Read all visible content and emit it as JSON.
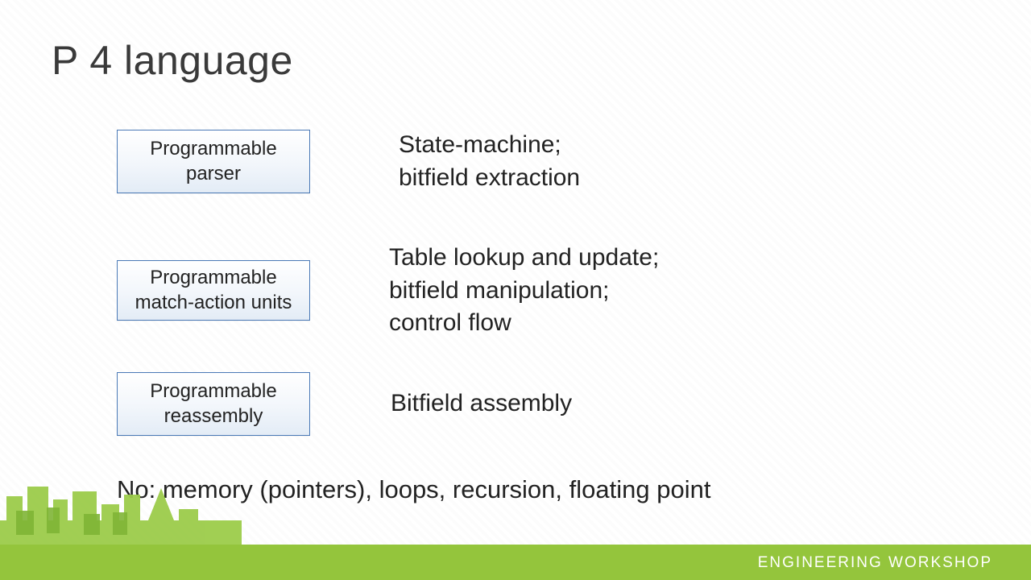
{
  "title": "P 4 language",
  "rows": [
    {
      "box": "Programmable\nparser",
      "desc": "State-machine;\nbitfield extraction"
    },
    {
      "box": "Programmable\nmatch-action\nunits",
      "desc": "Table lookup and update;\nbitfield manipulation;\ncontrol flow"
    },
    {
      "box": "Programmable\nreassembly",
      "desc": "Bitfield assembly"
    }
  ],
  "footnote": "No: memory (pointers), loops, recursion, floating point",
  "footer": "ENGINEERING WORKSHOP"
}
